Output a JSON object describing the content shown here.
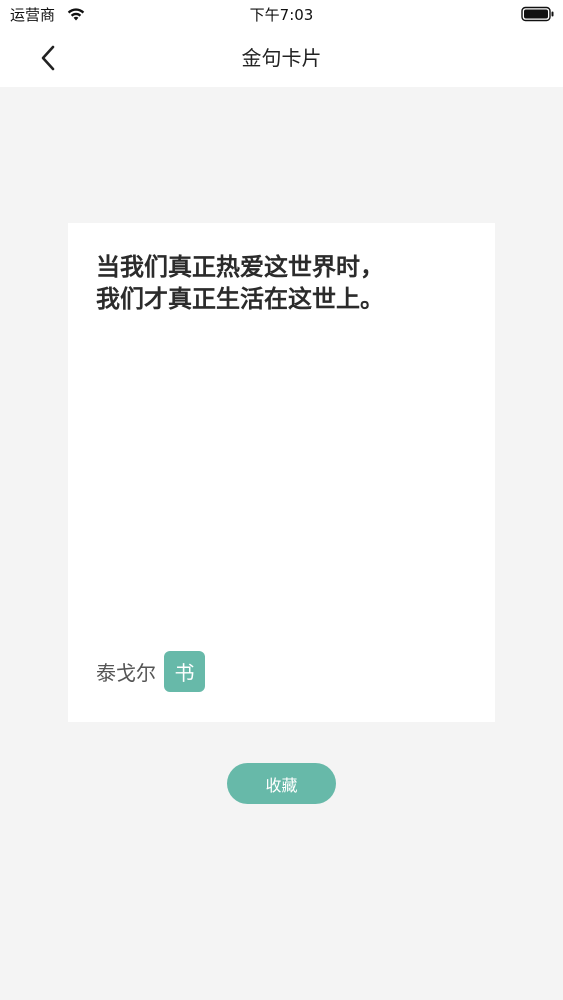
{
  "status_bar": {
    "carrier": "运营商",
    "time": "下午7:03",
    "icons": [
      "wifi-icon",
      "battery-icon"
    ]
  },
  "nav": {
    "title": "金句卡片",
    "back_icon": "chevron-left-icon"
  },
  "card": {
    "quote": "当我们真正热爱这世界时，\n我们才真正生活在这世上。",
    "author": "泰戈尔",
    "book_badge": "书"
  },
  "actions": {
    "collect_label": "收藏"
  },
  "colors": {
    "accent": "#67b9a9",
    "background": "#f4f4f4",
    "card": "#ffffff"
  }
}
